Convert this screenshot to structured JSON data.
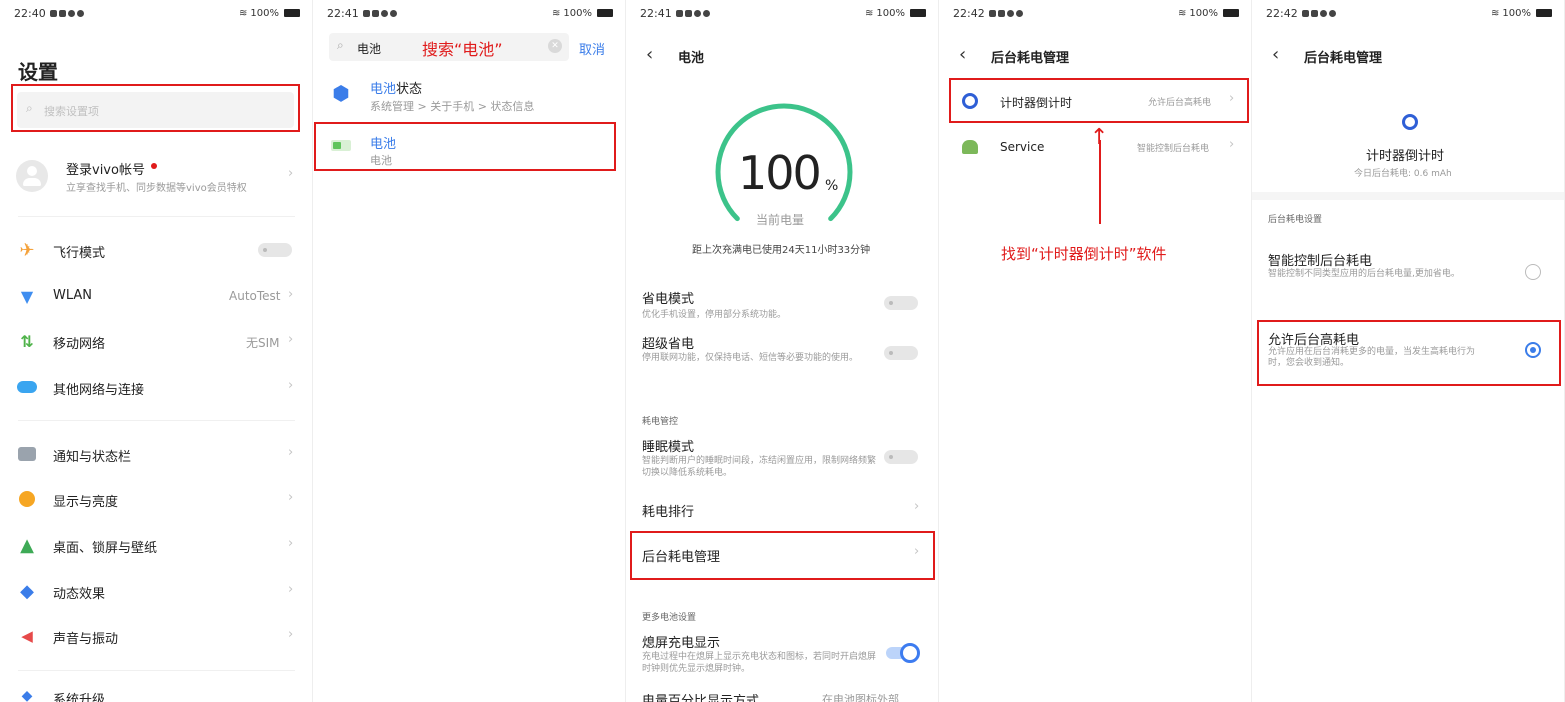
{
  "statusbar": {
    "p1_time": "22:40",
    "p2_time": "22:41",
    "p3_time": "22:41",
    "p4_time": "22:42",
    "p5_time": "22:42",
    "battery": "100%"
  },
  "p1": {
    "title": "设置",
    "search_placeholder": "搜索设置项",
    "account_title": "登录vivo帐号",
    "account_sub": "立享查找手机、同步数据等vivo会员特权",
    "items": [
      {
        "label": "飞行模式"
      },
      {
        "label": "WLAN",
        "value": "AutoTest"
      },
      {
        "label": "移动网络",
        "value": "无SIM"
      },
      {
        "label": "其他网络与连接"
      },
      {
        "label": "通知与状态栏"
      },
      {
        "label": "显示与亮度"
      },
      {
        "label": "桌面、锁屏与壁纸"
      },
      {
        "label": "动态效果"
      },
      {
        "label": "声音与振动"
      },
      {
        "label": "系统升级"
      }
    ],
    "accent": "#e01b1b"
  },
  "p2": {
    "search_value": "电池",
    "annotation": "搜索“电池”",
    "cancel": "取消",
    "r1_title_hl": "电池",
    "r1_title_rest": "状态",
    "r1_sub": "系统管理 > 关于手机 > 状态信息",
    "r2_title": "电池",
    "r2_sub": "电池"
  },
  "p3": {
    "title": "电池",
    "percent": "100",
    "percent_unit": "%",
    "current": "当前电量",
    "since": "距上次充满电已使用24天11小时33分钟",
    "battery_level_pct": 100,
    "save_title": "省电模式",
    "save_sub": "优化手机设置，停用部分系统功能。",
    "super_title": "超级省电",
    "super_sub": "停用联网功能，仅保持电话、短信等必要功能的使用。",
    "sec1": "耗电管控",
    "sleep_title": "睡眠模式",
    "sleep_sub": "智能判断用户的睡眠时间段，冻结闲置应用，限制网络频繁切换以降低系统耗电。",
    "rank": "耗电排行",
    "bg": "后台耗电管理",
    "sec2": "更多电池设置",
    "screen_title": "熄屏充电显示",
    "screen_sub": "充电过程中在熄屏上显示充电状态和图标，若同时开启熄屏时钟则优先显示熄屏时钟。",
    "cut": "电量百分比显示方式",
    "cut_value": "在电池图标外部"
  },
  "p4": {
    "title": "后台耗电管理",
    "app1": "计时器倒计时",
    "app1_value": "允许后台高耗电",
    "app2": "Service",
    "app2_value": "智能控制后台耗电",
    "annotation": "找到“计时器倒计时”软件"
  },
  "p5": {
    "title": "后台耗电管理",
    "app": "计时器倒计时",
    "today": "今日后台耗电: 0.6 mAh",
    "section": "后台耗电设置",
    "opt1_title": "智能控制后台耗电",
    "opt1_sub": "智能控制不同类型应用的后台耗电量,更加省电。",
    "opt2_title": "允许后台高耗电",
    "opt2_sub": "允许应用在后台消耗更多的电量，当发生高耗电行为时，您会收到通知。"
  }
}
